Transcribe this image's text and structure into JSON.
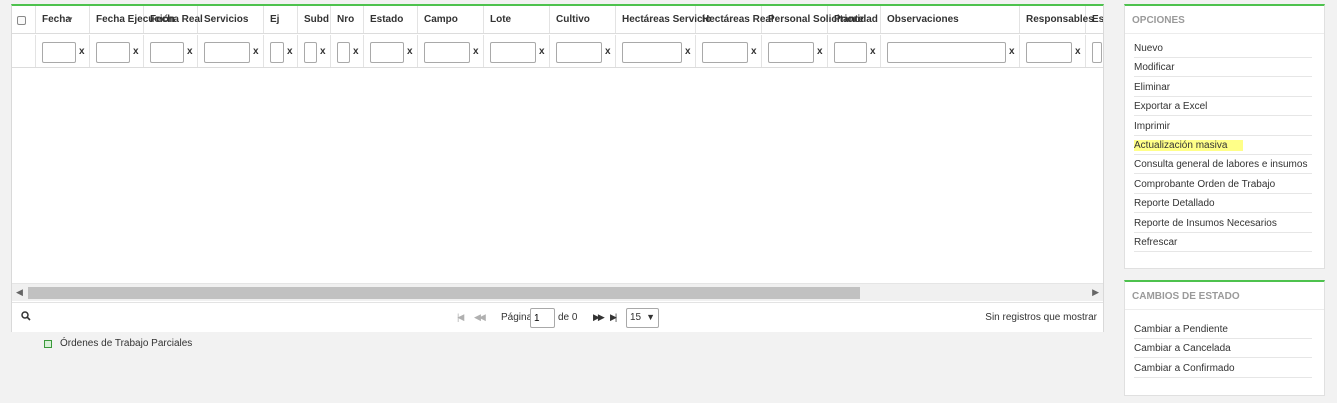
{
  "grid": {
    "columns": [
      {
        "label": "",
        "checkbox": true
      },
      {
        "label": "Fecha",
        "sort": "▼"
      },
      {
        "label": "Fecha Ejecución"
      },
      {
        "label": "Fecha Real"
      },
      {
        "label": "Servicios"
      },
      {
        "label": "Ej"
      },
      {
        "label": "Subd"
      },
      {
        "label": "Nro"
      },
      {
        "label": "Estado"
      },
      {
        "label": "Campo"
      },
      {
        "label": "Lote"
      },
      {
        "label": "Cultivo"
      },
      {
        "label": "Hectáreas Servicio"
      },
      {
        "label": "Hectáreas Real"
      },
      {
        "label": "Personal Solicitante"
      },
      {
        "label": "Prioridad"
      },
      {
        "label": "Observaciones"
      },
      {
        "label": "Responsables"
      },
      {
        "label": "Estado"
      }
    ],
    "filter_clear_label": "x",
    "pager": {
      "page_label": "Página",
      "page_value": "1",
      "of_label": "de 0",
      "page_size": "15",
      "status": "Sin registros que mostrar"
    }
  },
  "partial_orders": "Órdenes de Trabajo Parciales",
  "options_panel": {
    "title": "OPCIONES",
    "items": [
      "Nuevo",
      "Modificar",
      "Eliminar",
      "Exportar a Excel",
      "Imprimir",
      "Actualización masiva",
      "Consulta general de labores e insumos",
      "Comprobante Orden de Trabajo",
      "Reporte Detallado",
      "Reporte de Insumos Necesarios",
      "Refrescar"
    ],
    "highlighted_item": "Actualización masiva"
  },
  "state_panel": {
    "title": "CAMBIOS DE ESTADO",
    "items": [
      "Cambiar a Pendiente",
      "Cambiar a Cancelada",
      "Cambiar a Confirmado"
    ]
  },
  "colors": {
    "accent": "#4ec24e",
    "highlight": "#ffff88"
  }
}
